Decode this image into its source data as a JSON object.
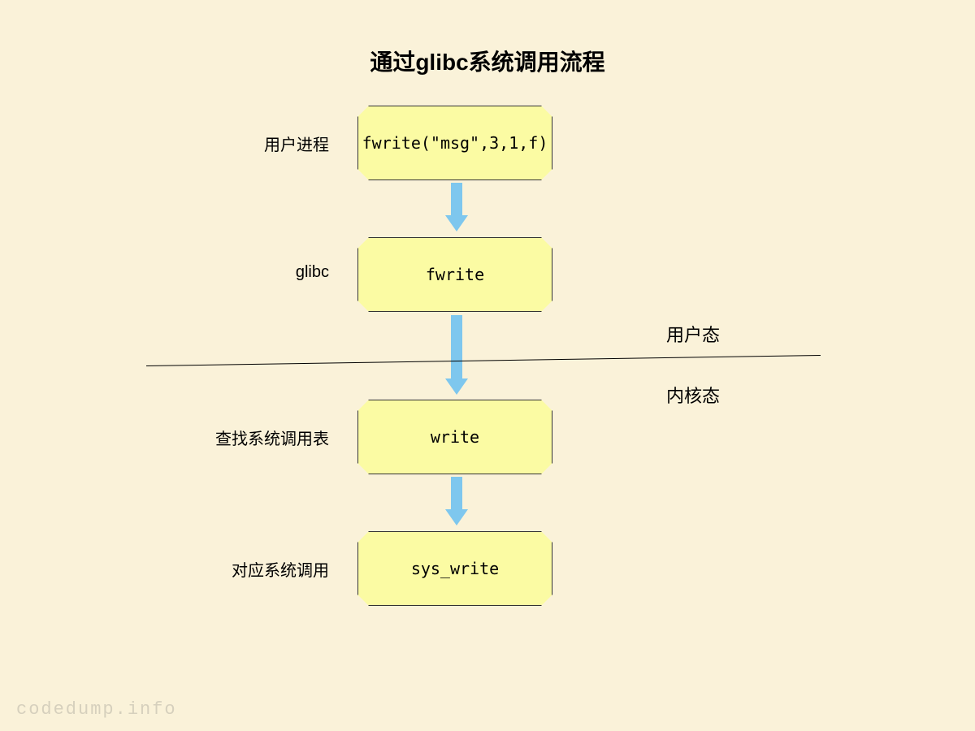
{
  "title": "通过glibc系统调用流程",
  "nodes": [
    {
      "id": "n1",
      "label": "fwrite(\"msg\",3,1,f)",
      "side_label": "用户进程"
    },
    {
      "id": "n2",
      "label": "fwrite",
      "side_label": "glibc"
    },
    {
      "id": "n3",
      "label": "write",
      "side_label": "查找系统调用表"
    },
    {
      "id": "n4",
      "label": "sys_write",
      "side_label": "对应系统调用"
    }
  ],
  "modes": {
    "user": "用户态",
    "kernel": "内核态"
  },
  "watermark": "codedump.info"
}
